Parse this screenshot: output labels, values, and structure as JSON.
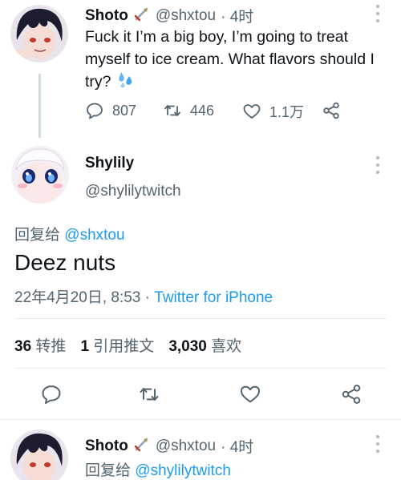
{
  "tweet1": {
    "name": "Shoto",
    "handle": "@shxtou",
    "time": "· 4时",
    "text": "Fuck it I’m a big boy, I’m going to treat myself to ice cream. What flavors should I try?",
    "reply_count": "807",
    "retweet_count": "446",
    "like_count": "1.1万"
  },
  "main": {
    "name": "Shylily",
    "handle": "@shylilytwitch",
    "reply_prefix": "回复给",
    "reply_to": "@shxtou",
    "text": "Deez nuts",
    "timestamp": "22年4月20日, 8:53 ·",
    "source": "Twitter for iPhone",
    "retweets_num": "36",
    "retweets_label": "转推",
    "quotes_num": "1",
    "quotes_label": "引用推文",
    "likes_num": "3,030",
    "likes_label": "喜欢"
  },
  "tweet3": {
    "name": "Shoto",
    "handle": "@shxtou",
    "time": "· 4时",
    "reply_prefix": "回复给",
    "reply_to": "@shylilytwitch"
  },
  "colors": {
    "text": "#0f1419",
    "secondary": "#536471",
    "link": "#1d9bf0"
  }
}
